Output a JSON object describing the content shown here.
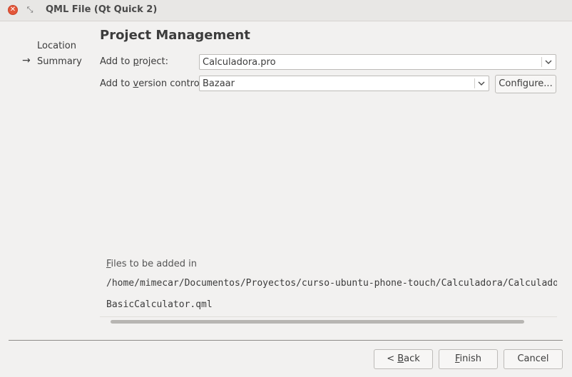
{
  "window": {
    "title": "QML File (Qt Quick 2)",
    "close_glyph": "✕",
    "restore_glyph": "⤡"
  },
  "steps": [
    {
      "label": "Location",
      "current": false
    },
    {
      "label": "Summary",
      "current": true
    }
  ],
  "step_arrow": "→",
  "page": {
    "title": "Project Management"
  },
  "form": {
    "project_label_pre": "Add to ",
    "project_label_mnemonic": "p",
    "project_label_post": "roject:",
    "project_value": "Calculadora.pro",
    "vcs_label_pre": "Add to ",
    "vcs_label_mnemonic": "v",
    "vcs_label_post": "ersion control:",
    "vcs_value": "Bazaar",
    "configure_label": "Configure..."
  },
  "files": {
    "heading_mnemonic": "F",
    "heading_rest": "iles to be added in",
    "path": "/home/mimecar/Documentos/Proyectos/curso-ubuntu-phone-touch/Calculadora/Calculadora",
    "items": [
      "BasicCalculator.qml"
    ]
  },
  "buttons": {
    "back_pre": "< ",
    "back_mnemonic": "B",
    "back_rest": "ack",
    "finish_mnemonic": "F",
    "finish_rest": "inish",
    "cancel": "Cancel"
  },
  "colors": {
    "close_button": "#e3573a",
    "background": "#f2f1f0"
  }
}
